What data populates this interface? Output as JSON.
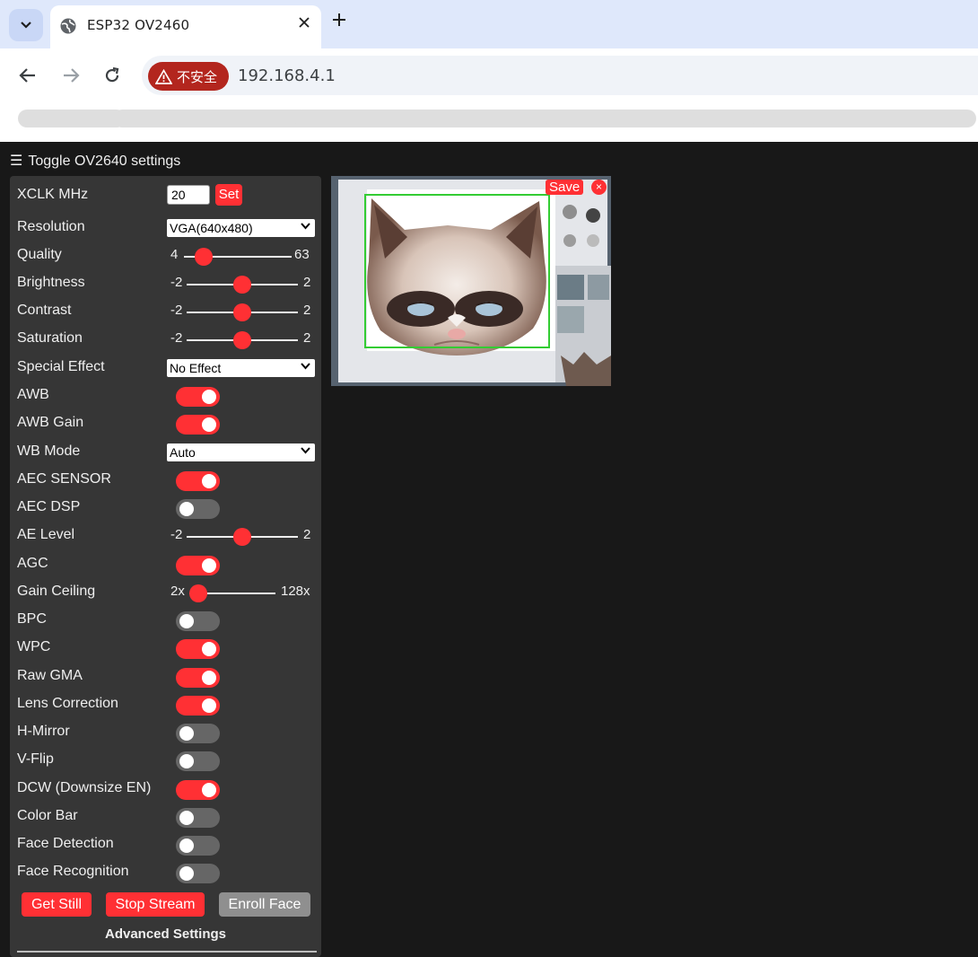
{
  "browser": {
    "tab_title": "ESP32 OV2460",
    "security_label": "不安全",
    "url": "192.168.4.1"
  },
  "page": {
    "toggle_label": "Toggle OV2640 settings",
    "xclk": {
      "label": "XCLK MHz",
      "value": "20",
      "button": "Set"
    },
    "resolution": {
      "label": "Resolution",
      "value": "VGA(640x480)"
    },
    "quality": {
      "label": "Quality",
      "min": "4",
      "max": "63",
      "value": 10
    },
    "brightness": {
      "label": "Brightness",
      "min": "-2",
      "max": "2",
      "value": 0
    },
    "contrast": {
      "label": "Contrast",
      "min": "-2",
      "max": "2",
      "value": 0
    },
    "saturation": {
      "label": "Saturation",
      "min": "-2",
      "max": "2",
      "value": 0
    },
    "special_effect": {
      "label": "Special Effect",
      "value": "No Effect"
    },
    "awb": {
      "label": "AWB",
      "on": true
    },
    "awb_gain": {
      "label": "AWB Gain",
      "on": true
    },
    "wb_mode": {
      "label": "WB Mode",
      "value": "Auto"
    },
    "aec_sensor": {
      "label": "AEC SENSOR",
      "on": true
    },
    "aec_dsp": {
      "label": "AEC DSP",
      "on": false
    },
    "ae_level": {
      "label": "AE Level",
      "min": "-2",
      "max": "2",
      "value": 0
    },
    "agc": {
      "label": "AGC",
      "on": true
    },
    "gain_ceiling": {
      "label": "Gain Ceiling",
      "min": "2x",
      "max": "128x",
      "value": 0
    },
    "bpc": {
      "label": "BPC",
      "on": false
    },
    "wpc": {
      "label": "WPC",
      "on": true
    },
    "raw_gma": {
      "label": "Raw GMA",
      "on": true
    },
    "lens_correction": {
      "label": "Lens Correction",
      "on": true
    },
    "hmirror": {
      "label": "H-Mirror",
      "on": false
    },
    "vflip": {
      "label": "V-Flip",
      "on": false
    },
    "dcw": {
      "label": "DCW (Downsize EN)",
      "on": true
    },
    "colorbar": {
      "label": "Color Bar",
      "on": false
    },
    "face_detect": {
      "label": "Face Detection",
      "on": false
    },
    "face_recognize": {
      "label": "Face Recognition",
      "on": false
    },
    "buttons": {
      "get_still": "Get Still",
      "stop_stream": "Stop Stream",
      "enroll_face": "Enroll Face"
    },
    "advanced_label": "Advanced Settings",
    "stream": {
      "save_label": "Save",
      "close_label": "×"
    }
  },
  "colors": {
    "accent": "#ff3034",
    "panel": "#363636",
    "background": "#181818"
  }
}
